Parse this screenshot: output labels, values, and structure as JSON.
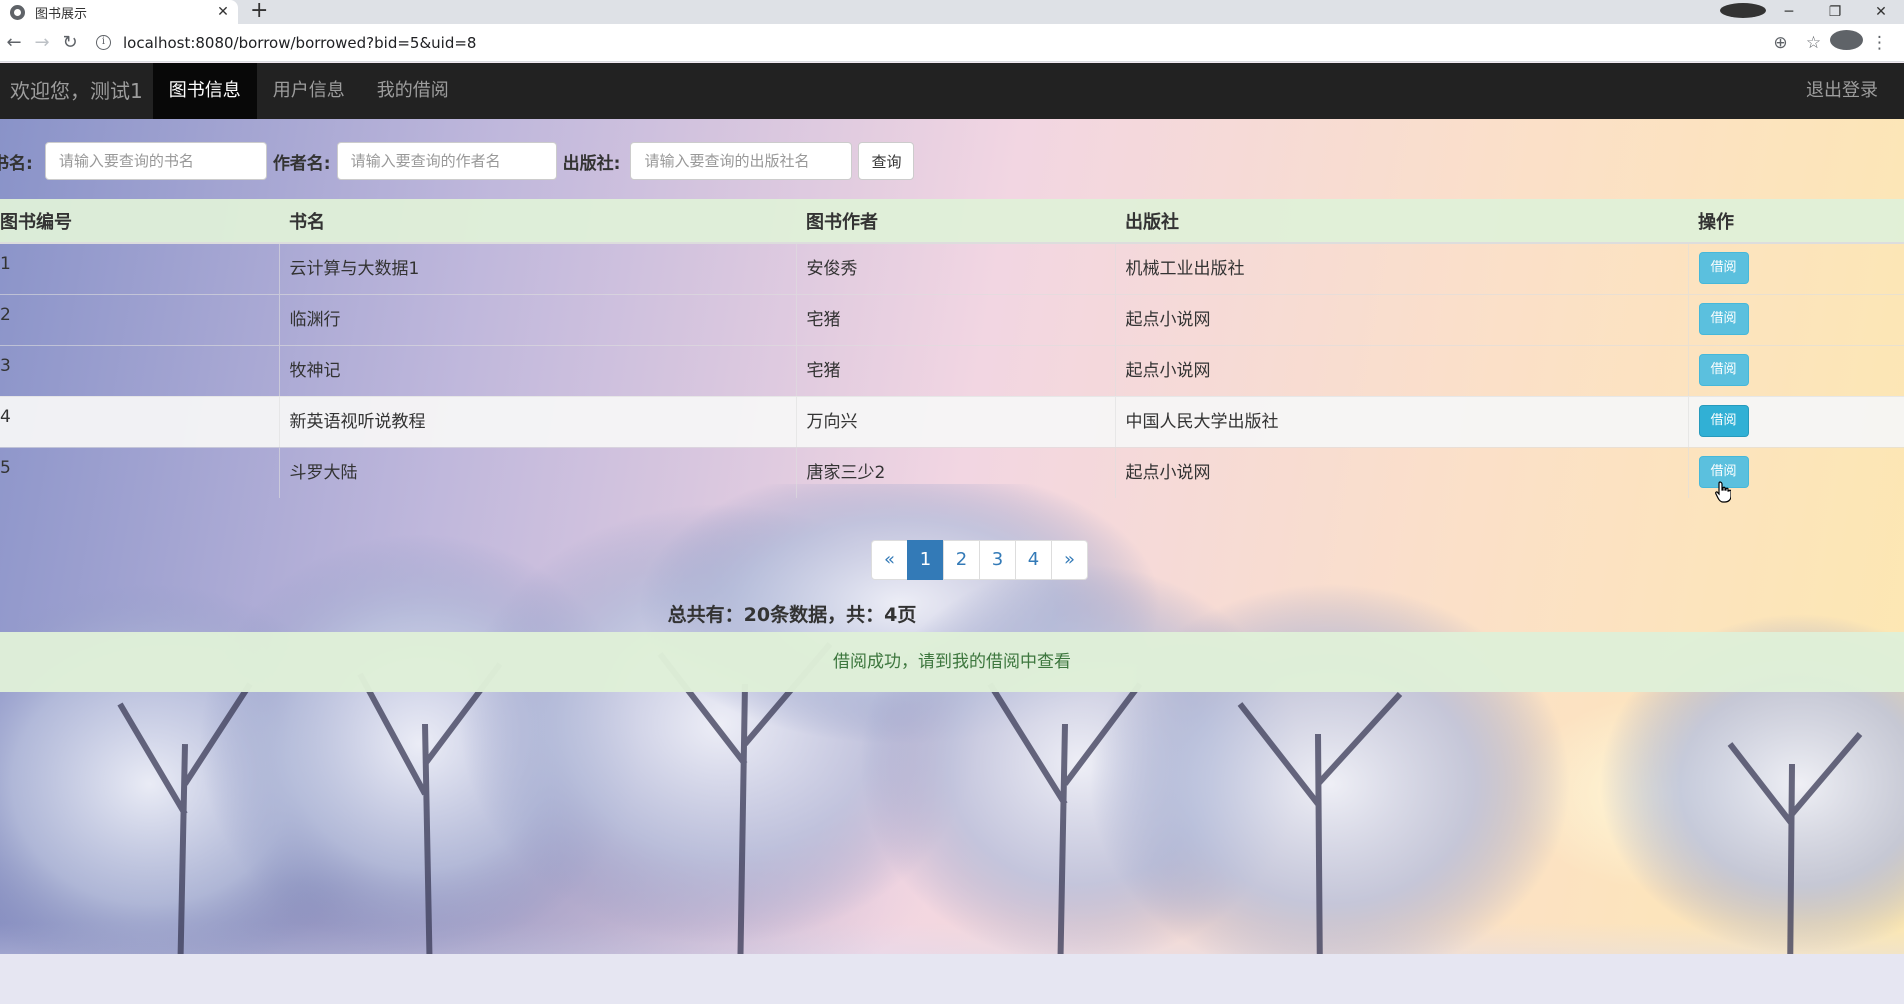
{
  "browser": {
    "tab_title": "图书展示",
    "url": "localhost:8080/borrow/borrowed?bid=5&uid=8",
    "tab_close": "✕",
    "new_tab": "+"
  },
  "nav": {
    "welcome": "欢迎您，测试1",
    "items": [
      "图书信息",
      "用户信息",
      "我的借阅"
    ],
    "active_index": 0,
    "logout": "退出登录"
  },
  "search": {
    "book_label": "书名:",
    "book_placeholder": "请输入要查询的书名",
    "author_label": "作者名:",
    "author_placeholder": "请输入要查询的作者名",
    "publisher_label": "出版社:",
    "publisher_placeholder": "请输入要查询的出版社名",
    "query_button": "查询"
  },
  "table": {
    "headers": [
      "图书编号",
      "书名",
      "图书作者",
      "出版社",
      "操作"
    ],
    "rows": [
      {
        "id": "1",
        "name": "云计算与大数据1",
        "author": "安俊秀",
        "publisher": "机械工业出版社",
        "action": "借阅"
      },
      {
        "id": "2",
        "name": "临渊行",
        "author": "宅猪",
        "publisher": "起点小说网",
        "action": "借阅"
      },
      {
        "id": "3",
        "name": "牧神记",
        "author": "宅猪",
        "publisher": "起点小说网",
        "action": "借阅"
      },
      {
        "id": "4",
        "name": "新英语视听说教程",
        "author": "万向兴",
        "publisher": "中国人民大学出版社",
        "action": "借阅"
      },
      {
        "id": "5",
        "name": "斗罗大陆",
        "author": "唐家三少2",
        "publisher": "起点小说网",
        "action": "借阅"
      }
    ]
  },
  "pagination": {
    "prev": "«",
    "pages": [
      "1",
      "2",
      "3",
      "4"
    ],
    "current": "1",
    "next": "»"
  },
  "summary": "总共有：20条数据，共：4页",
  "alert": "借阅成功，请到我的借阅中查看",
  "colors": {
    "navbar": "#222222",
    "nav_active": "#080808",
    "header_row": "#dff0d8",
    "borrow_button": "#5bc0de",
    "pagination_active": "#337ab7",
    "alert_text": "#3c763d"
  }
}
